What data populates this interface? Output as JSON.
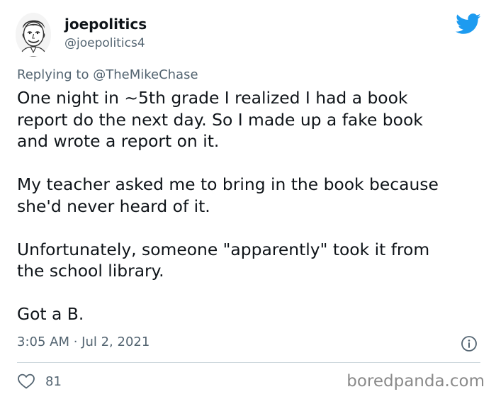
{
  "author": {
    "display_name": "joepolitics",
    "handle": "@joepolitics4",
    "avatar_icon": "user-avatar-sketch"
  },
  "reply": {
    "prefix": "Replying to",
    "mention": "@TheMikeChase"
  },
  "body": {
    "para1_line1": "One night in ~5th grade I realized I had a book",
    "para1_line2": "report do the next day. So I made up a fake book",
    "para1_line3": "and wrote a report on it.",
    "para2_line1": "My teacher asked me to bring in the book because",
    "para2_line2": "she'd never heard of it.",
    "para3_line1": "Unfortunately, someone \"apparently\" took it from",
    "para3_line2": "the school library.",
    "para4_line1": "Got a B."
  },
  "meta": {
    "timestamp": "3:05 AM · Jul 2, 2021"
  },
  "actions": {
    "like_count": "81",
    "like_icon": "heart-icon",
    "info_icon": "info-icon"
  },
  "watermark": {
    "text": "boredpanda.com"
  },
  "colors": {
    "text_primary": "#0f1419",
    "text_secondary": "#536471",
    "twitter_blue": "#1d9bf0",
    "divider": "#cfd9de",
    "watermark": "#8a8a8a"
  }
}
